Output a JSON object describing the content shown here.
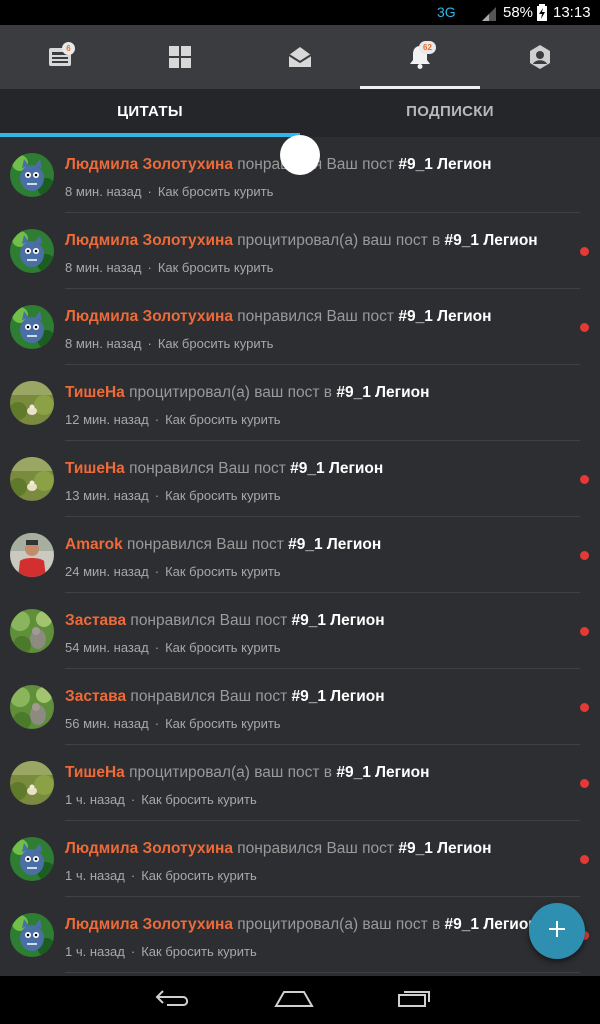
{
  "status_bar": {
    "network": "3G",
    "battery": "58%",
    "time": "13:13"
  },
  "top_nav": {
    "items": [
      {
        "icon": "news-feed-icon",
        "badge": "6"
      },
      {
        "icon": "grid-icon",
        "badge": ""
      },
      {
        "icon": "mail-icon",
        "badge": ""
      },
      {
        "icon": "bell-icon",
        "badge": "62",
        "active": true
      },
      {
        "icon": "profile-icon",
        "badge": ""
      }
    ]
  },
  "tabs": [
    {
      "label": "ЦИТАТЫ",
      "active": true
    },
    {
      "label": "ПОДПИСКИ",
      "active": false
    }
  ],
  "notifications": [
    {
      "user": "Людмила Золотухина",
      "action": "понравился Ваш пост",
      "post": "#9_1 Легион",
      "time": "8 мин. назад",
      "topic": "Как бросить курить",
      "avatar": "cat",
      "unread": false
    },
    {
      "user": "Людмила Золотухина",
      "action": "процитировал(а) ваш пост в",
      "post": "#9_1 Легион",
      "time": "8 мин. назад",
      "topic": "Как бросить курить",
      "avatar": "cat",
      "unread": true
    },
    {
      "user": "Людмила Золотухина",
      "action": "понравился Ваш пост",
      "post": "#9_1 Легион",
      "time": "8 мин. назад",
      "topic": "Как бросить курить",
      "avatar": "cat",
      "unread": true
    },
    {
      "user": "ТишеНа",
      "action": "процитировал(а) ваш пост в",
      "post": "#9_1 Легион",
      "time": "12 мин. назад",
      "topic": "Как бросить курить",
      "avatar": "grass",
      "unread": false
    },
    {
      "user": "ТишеНа",
      "action": "понравился Ваш пост",
      "post": "#9_1 Легион",
      "time": "13 мин. назад",
      "topic": "Как бросить курить",
      "avatar": "grass",
      "unread": true
    },
    {
      "user": "Amarok",
      "action": "понравился Ваш пост",
      "post": "#9_1 Легион",
      "time": "24 мин. назад",
      "topic": "Как бросить курить",
      "avatar": "person",
      "unread": true
    },
    {
      "user": "Застава",
      "action": "понравился Ваш пост",
      "post": "#9_1 Легион",
      "time": "54 мин. назад",
      "topic": "Как бросить курить",
      "avatar": "field",
      "unread": true
    },
    {
      "user": "Застава",
      "action": "понравился Ваш пост",
      "post": "#9_1 Легион",
      "time": "56 мин. назад",
      "topic": "Как бросить курить",
      "avatar": "field",
      "unread": true
    },
    {
      "user": "ТишеНа",
      "action": "процитировал(а) ваш пост в",
      "post": "#9_1 Легион",
      "time": "1 ч. назад",
      "topic": "Как бросить курить",
      "avatar": "grass",
      "unread": true
    },
    {
      "user": "Людмила Золотухина",
      "action": "понравился Ваш пост",
      "post": "#9_1 Легион",
      "time": "1 ч. назад",
      "topic": "Как бросить курить",
      "avatar": "cat",
      "unread": true
    },
    {
      "user": "Людмила Золотухина",
      "action": "процитировал(а) ваш пост в",
      "post": "#9_1 Легион",
      "time": "1 ч. назад",
      "topic": "Как бросить курить",
      "avatar": "cat",
      "unread": true
    }
  ],
  "separator": "·",
  "fab": {
    "icon": "plus-icon"
  },
  "system_nav": {
    "buttons": [
      "back-icon",
      "home-icon",
      "recents-icon"
    ]
  },
  "colors": {
    "accent": "#33b5e5",
    "username": "#ee6a38",
    "unread_dot": "#e53935",
    "fab": "#2f8fb0"
  }
}
